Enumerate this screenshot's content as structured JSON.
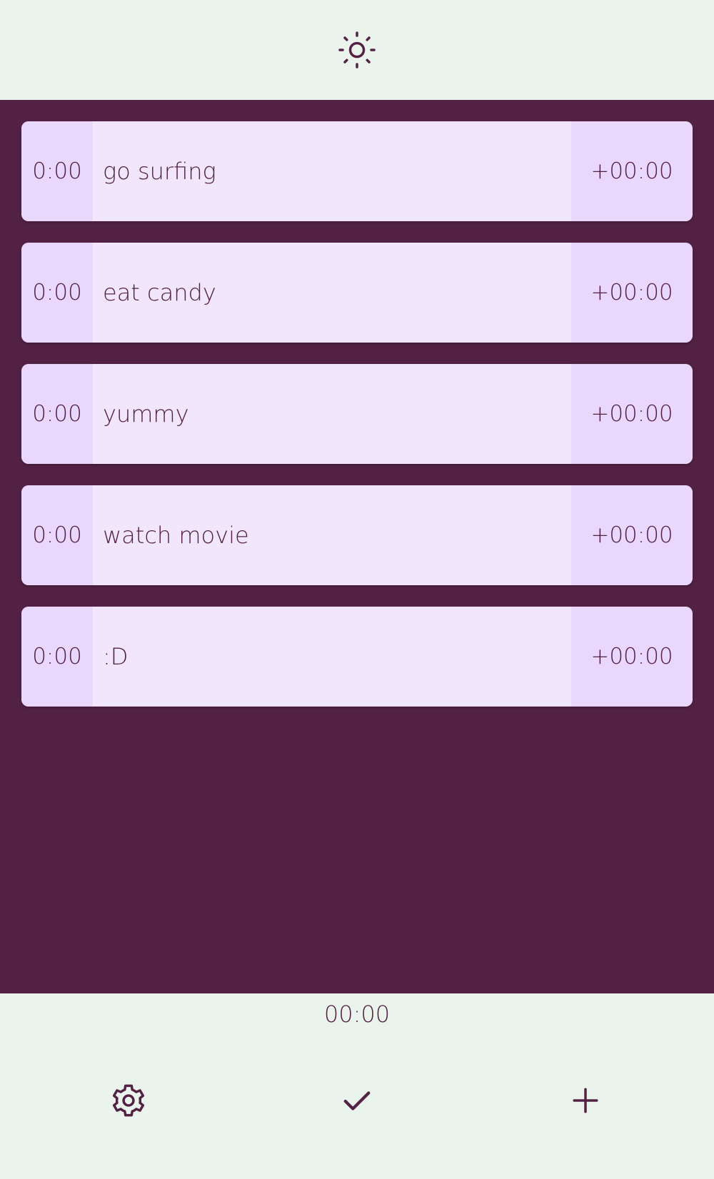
{
  "header": {
    "theme_icon": "sun-icon"
  },
  "tasks": [
    {
      "duration": "0:00",
      "name": "go surfing",
      "offset": "+00:00"
    },
    {
      "duration": "0:00",
      "name": "eat candy",
      "offset": "+00:00"
    },
    {
      "duration": "0:00",
      "name": "yummy",
      "offset": "+00:00"
    },
    {
      "duration": "0:00",
      "name": "watch movie",
      "offset": "+00:00"
    },
    {
      "duration": "0:00",
      "name": ":D",
      "offset": "+00:00"
    }
  ],
  "footer": {
    "total_time": "00:00",
    "settings_icon": "gear-icon",
    "complete_icon": "checkmark-icon",
    "add_icon": "plus-icon"
  },
  "colors": {
    "background": "#EBF4EC",
    "accent": "#522143",
    "card": "#F2E6FD",
    "card_side": "#EAD7FD"
  }
}
